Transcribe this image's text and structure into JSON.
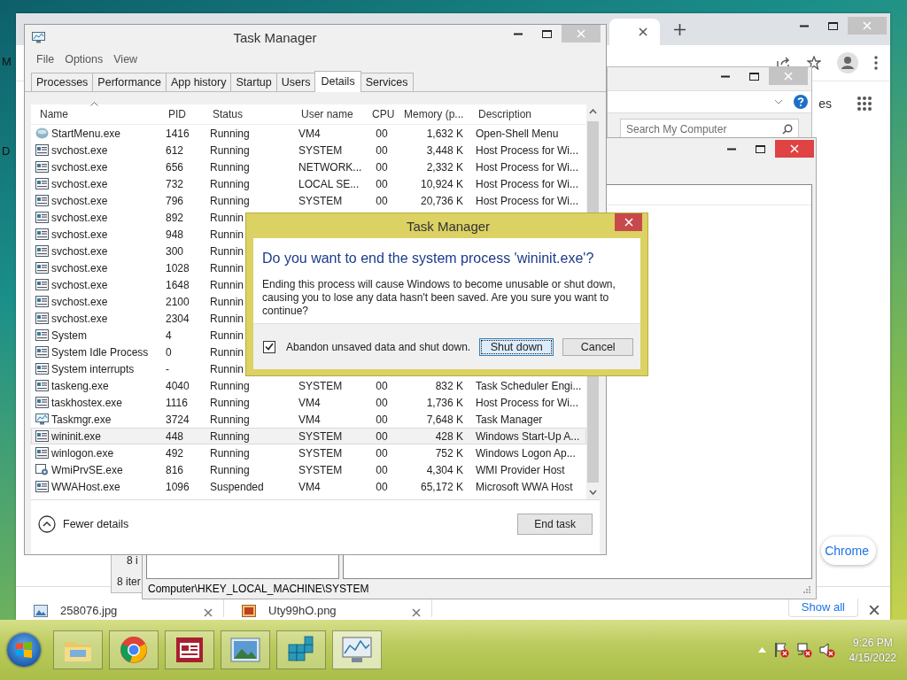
{
  "desktop": {
    "fragments": [
      "M",
      "D"
    ]
  },
  "browser": {
    "side_text": "es",
    "promo_button": "Chrome",
    "downloads": [
      {
        "name": "258076.jpg",
        "kind": "image"
      },
      {
        "name": "Uty99hO.png",
        "kind": "photo"
      }
    ],
    "show_all": "Show all"
  },
  "explorer": {
    "search_placeholder": "Search My Computer"
  },
  "back_window": {
    "texts": [
      "8 i",
      "8 iter"
    ]
  },
  "regedit": {
    "status_bar": "Computer\\HKEY_LOCAL_MACHINE\\SYSTEM"
  },
  "task_manager": {
    "title": "Task Manager",
    "menu": [
      "File",
      "Options",
      "View"
    ],
    "tabs": [
      {
        "label": "Processes",
        "selected": false
      },
      {
        "label": "Performance",
        "selected": false
      },
      {
        "label": "App history",
        "selected": false
      },
      {
        "label": "Startup",
        "selected": false
      },
      {
        "label": "Users",
        "selected": false
      },
      {
        "label": "Details",
        "selected": true
      },
      {
        "label": "Services",
        "selected": false
      }
    ],
    "columns": [
      "Name",
      "PID",
      "Status",
      "User name",
      "CPU",
      "Memory (p...",
      "Description"
    ],
    "rows": [
      {
        "kind": "shell",
        "name": "StartMenu.exe",
        "pid": "1416",
        "status": "Running",
        "user": "VM4",
        "cpu": "00",
        "memory": "1,632 K",
        "description": "Open-Shell Menu",
        "selected": false
      },
      {
        "kind": "app",
        "name": "svchost.exe",
        "pid": "612",
        "status": "Running",
        "user": "SYSTEM",
        "cpu": "00",
        "memory": "3,448 K",
        "description": "Host Process for Wi...",
        "selected": false
      },
      {
        "kind": "app",
        "name": "svchost.exe",
        "pid": "656",
        "status": "Running",
        "user": "NETWORK...",
        "cpu": "00",
        "memory": "2,332 K",
        "description": "Host Process for Wi...",
        "selected": false
      },
      {
        "kind": "app",
        "name": "svchost.exe",
        "pid": "732",
        "status": "Running",
        "user": "LOCAL SE...",
        "cpu": "00",
        "memory": "10,924 K",
        "description": "Host Process for Wi...",
        "selected": false
      },
      {
        "kind": "app",
        "name": "svchost.exe",
        "pid": "796",
        "status": "Running",
        "user": "SYSTEM",
        "cpu": "00",
        "memory": "20,736 K",
        "description": "Host Process for Wi...",
        "selected": false
      },
      {
        "kind": "app",
        "name": "svchost.exe",
        "pid": "892",
        "status": "Runnin",
        "selected": false
      },
      {
        "kind": "app",
        "name": "svchost.exe",
        "pid": "948",
        "status": "Runnin",
        "selected": false
      },
      {
        "kind": "app",
        "name": "svchost.exe",
        "pid": "300",
        "status": "Runnin",
        "selected": false
      },
      {
        "kind": "app",
        "name": "svchost.exe",
        "pid": "1028",
        "status": "Runnin",
        "selected": false
      },
      {
        "kind": "app",
        "name": "svchost.exe",
        "pid": "1648",
        "status": "Runnin",
        "selected": false
      },
      {
        "kind": "app",
        "name": "svchost.exe",
        "pid": "2100",
        "status": "Runnin",
        "selected": false
      },
      {
        "kind": "app",
        "name": "svchost.exe",
        "pid": "2304",
        "status": "Runnin",
        "selected": false
      },
      {
        "kind": "app",
        "name": "System",
        "pid": "4",
        "status": "Runnin",
        "selected": false
      },
      {
        "kind": "app",
        "name": "System Idle Process",
        "pid": "0",
        "status": "Runnin",
        "selected": false
      },
      {
        "kind": "app",
        "name": "System interrupts",
        "pid": "-",
        "status": "Runnin",
        "selected": false
      },
      {
        "kind": "app",
        "name": "taskeng.exe",
        "pid": "4040",
        "status": "Running",
        "user": "SYSTEM",
        "cpu": "00",
        "memory": "832 K",
        "description": "Task Scheduler Engi...",
        "selected": false
      },
      {
        "kind": "app",
        "name": "taskhostex.exe",
        "pid": "1116",
        "status": "Running",
        "user": "VM4",
        "cpu": "00",
        "memory": "1,736 K",
        "description": "Host Process for Wi...",
        "selected": false
      },
      {
        "kind": "monitor",
        "name": "Taskmgr.exe",
        "pid": "3724",
        "status": "Running",
        "user": "VM4",
        "cpu": "00",
        "memory": "7,648 K",
        "description": "Task Manager",
        "selected": false
      },
      {
        "kind": "app",
        "name": "wininit.exe",
        "pid": "448",
        "status": "Running",
        "user": "SYSTEM",
        "cpu": "00",
        "memory": "428 K",
        "description": "Windows Start-Up A...",
        "selected": true
      },
      {
        "kind": "app",
        "name": "winlogon.exe",
        "pid": "492",
        "status": "Running",
        "user": "SYSTEM",
        "cpu": "00",
        "memory": "752 K",
        "description": "Windows Logon Ap...",
        "selected": false
      },
      {
        "kind": "gear",
        "name": "WmiPrvSE.exe",
        "pid": "816",
        "status": "Running",
        "user": "SYSTEM",
        "cpu": "00",
        "memory": "4,304 K",
        "description": "WMI Provider Host",
        "selected": false
      },
      {
        "kind": "app",
        "name": "WWAHost.exe",
        "pid": "1096",
        "status": "Suspended",
        "user": "VM4",
        "cpu": "00",
        "memory": "65,172 K",
        "description": "Microsoft WWA Host",
        "selected": false
      }
    ],
    "fewer_details": "Fewer details",
    "end_task": "End task"
  },
  "dialog": {
    "title": "Task Manager",
    "heading": "Do you want to end the system process 'wininit.exe'?",
    "message": "Ending this process will cause Windows to become unusable or shut down, causing you to lose any data hasn't been saved. Are you sure you want to continue?",
    "checkbox": {
      "label": "Abandon unsaved data and shut down.",
      "checked": true
    },
    "buttons": [
      {
        "label": "Shut down",
        "focused": true
      },
      {
        "label": "Cancel",
        "focused": false
      }
    ]
  },
  "taskbar": {
    "apps": [
      {
        "kind": "folder",
        "selected": false
      },
      {
        "kind": "browser",
        "selected": false
      },
      {
        "kind": "reader",
        "selected": false
      },
      {
        "kind": "picture",
        "selected": false
      },
      {
        "kind": "cubes",
        "selected": false
      },
      {
        "kind": "monitor",
        "selected": true
      }
    ],
    "time": "9:26 PM",
    "date": "4/15/2022"
  }
}
